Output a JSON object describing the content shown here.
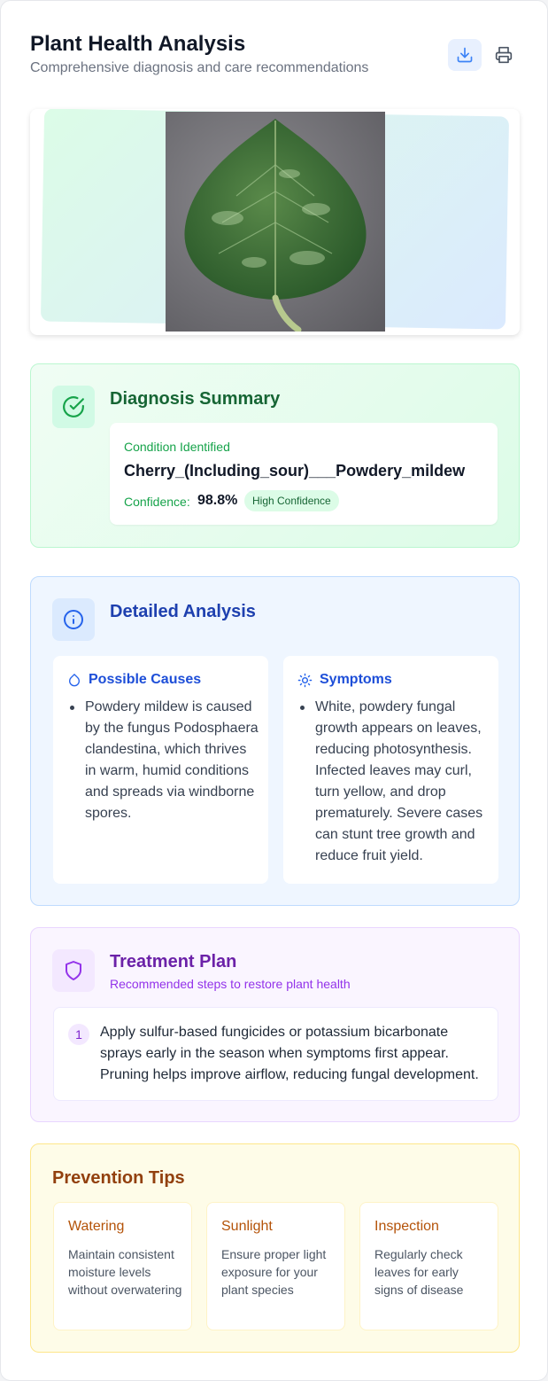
{
  "header": {
    "title": "Plant Health Analysis",
    "subtitle": "Comprehensive diagnosis and care recommendations",
    "download_icon": "download-icon",
    "print_icon": "printer-icon"
  },
  "diagnosis": {
    "title": "Diagnosis Summary",
    "icon": "check-circle-icon",
    "condition_label": "Condition Identified",
    "condition": "Cherry_(Including_sour)___Powdery_mildew",
    "confidence_label": "Confidence:",
    "confidence_value": "98.8%",
    "confidence_badge": "High Confidence"
  },
  "detailed": {
    "title": "Detailed Analysis",
    "icon": "info-icon",
    "causes": {
      "title": "Possible Causes",
      "icon": "droplet-icon",
      "text": "Powdery mildew is caused by the fungus Podosphaera clandestina, which thrives in warm, humid conditions and spreads via windborne spores."
    },
    "symptoms": {
      "title": "Symptoms",
      "icon": "sun-icon",
      "text": "White, powdery fungal growth appears on leaves, reducing photosynthesis. Infected leaves may curl, turn yellow, and drop prematurely. Severe cases can stunt tree growth and reduce fruit yield."
    }
  },
  "treatment": {
    "title": "Treatment Plan",
    "subtitle": "Recommended steps to restore plant health",
    "icon": "shield-icon",
    "steps": [
      {
        "number": "1",
        "text": "Apply sulfur-based fungicides or potassium bicarbonate sprays early in the season when symptoms first appear. Pruning helps improve airflow, reducing fungal development."
      }
    ]
  },
  "prevention": {
    "title": "Prevention Tips",
    "tips": [
      {
        "title": "Watering",
        "text": "Maintain consistent moisture levels without overwatering"
      },
      {
        "title": "Sunlight",
        "text": "Ensure proper light exposure for your plant species"
      },
      {
        "title": "Inspection",
        "text": "Regularly check leaves for early signs of disease"
      }
    ]
  },
  "colors": {
    "diagnosis_accent": "#166534",
    "analysis_accent": "#1e40af",
    "treatment_accent": "#6b21a8",
    "prevention_accent": "#92400e"
  }
}
